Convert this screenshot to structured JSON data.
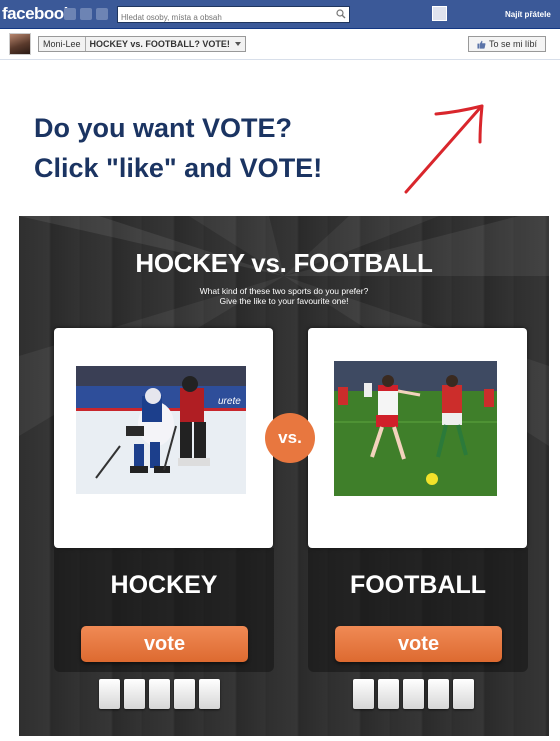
{
  "facebook": {
    "logo": "facebook",
    "search_placeholder": "Hledat osoby, místa a obsah",
    "find_friends": "Najít přátele"
  },
  "page": {
    "name": "Moni-Lee",
    "app_name": "HOCKEY vs. FOOTBALL? VOTE!",
    "like_button": "To se mi líbí"
  },
  "promo": {
    "line1": "Do you want VOTE?",
    "line2": "Click \"like\" and VOTE!",
    "arrow_color": "#d9262c"
  },
  "app": {
    "title": "HOCKEY vs. FOOTBALL",
    "subtitle_line1": "What kind of these two sports do you prefer?",
    "subtitle_line2": "Give the like to your favourite one!",
    "vs_label": "vs.",
    "accent_color": "#e8773f",
    "options": [
      {
        "name": "HOCKEY",
        "vote_label": "vote",
        "photo": "hockey-players-photo"
      },
      {
        "name": "FOOTBALL",
        "vote_label": "vote",
        "photo": "football-players-photo"
      }
    ]
  }
}
